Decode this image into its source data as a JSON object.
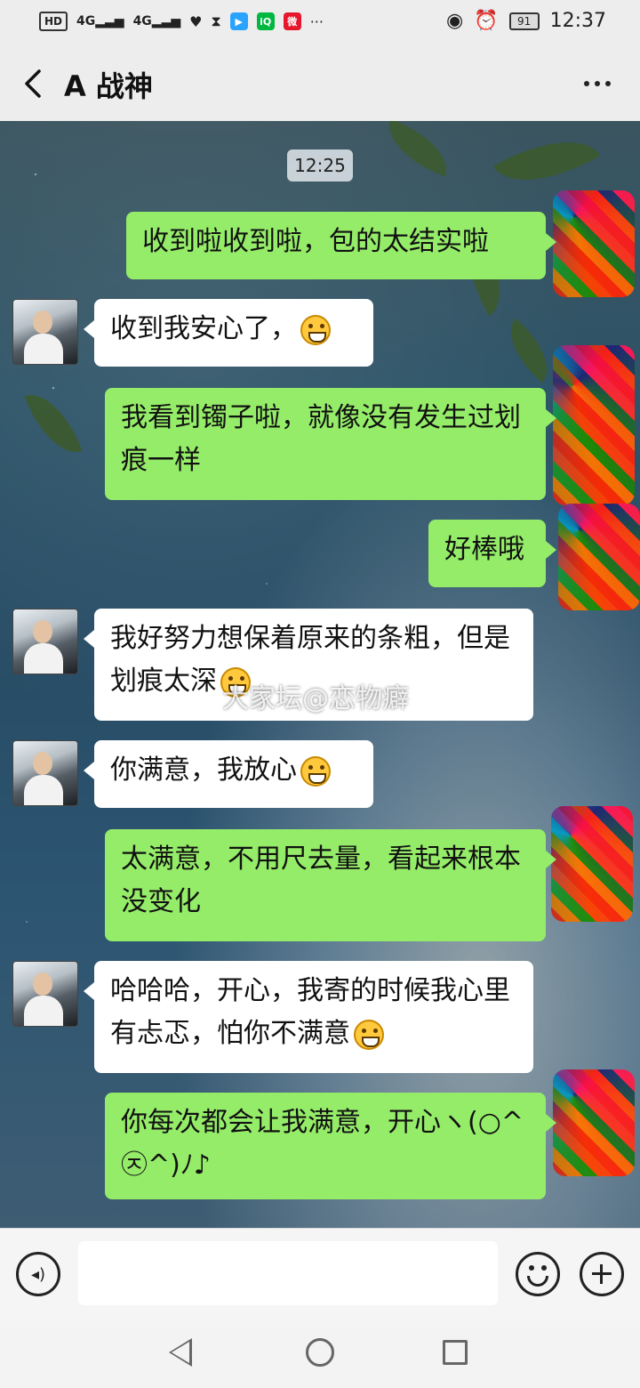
{
  "status_bar": {
    "hd": "HD",
    "net1": "4G",
    "net2": "4G",
    "battery": "91",
    "time": "12:37",
    "more": "···"
  },
  "title_bar": {
    "title": "A 战神"
  },
  "chat": {
    "timestamp": "12:25",
    "messages": [
      {
        "side": "out",
        "text": "收到啦收到啦，包的太结实啦"
      },
      {
        "side": "in",
        "text": "收到我安心了，"
      },
      {
        "side": "out",
        "text": "我看到镯子啦，就像没有发生过划痕一样"
      },
      {
        "side": "out",
        "text": "好棒哦"
      },
      {
        "side": "in",
        "text": "我好努力想保着原来的条粗，但是划痕太深"
      },
      {
        "side": "in",
        "text": "你满意，我放心"
      },
      {
        "side": "out",
        "text": "太满意，不用尺去量，看起来根本没变化"
      },
      {
        "side": "in",
        "text": "哈哈哈，开心，我寄的时候我心里有忐忑，怕你不满意"
      },
      {
        "side": "out",
        "text": "你每次都会让我满意，开心ヽ(○^㉨^)ﾉ♪"
      }
    ],
    "watermark": "大家坛@恋物癖"
  },
  "input_bar": {
    "value": ""
  }
}
